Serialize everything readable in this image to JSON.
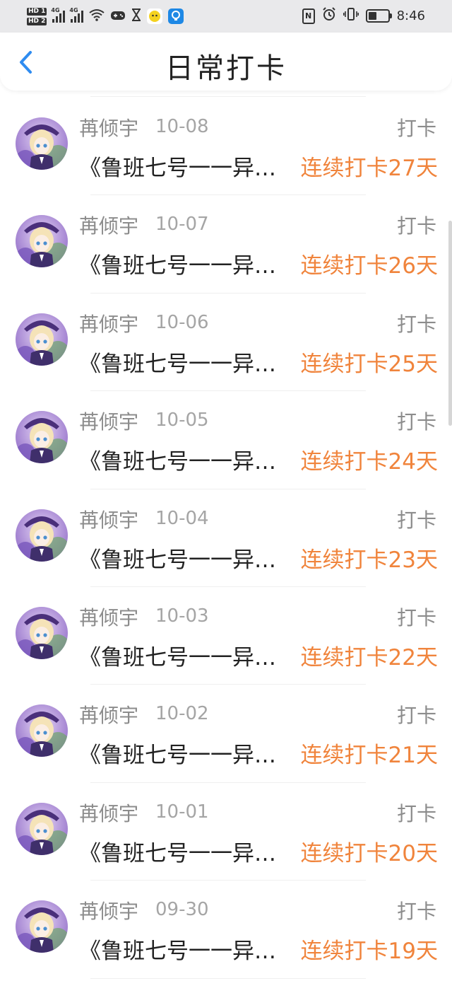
{
  "status_bar": {
    "sim1": "HD 1",
    "sim2": "HD 2",
    "network1": "4G",
    "network2": "4G",
    "time": "8:46",
    "battery_level": 0.5,
    "icons": [
      "signal-icon",
      "wifi-icon",
      "game-icon",
      "hourglass-icon",
      "app-icon",
      "app-icon",
      "nfc-icon",
      "alarm-icon",
      "vibrate-icon",
      "battery-icon"
    ]
  },
  "header": {
    "back_icon": "chevron-left-icon",
    "title": "日常打卡",
    "accent_color": "#2f8cf0"
  },
  "colors": {
    "streak": "#f0843c",
    "muted": "#8c8c8c"
  },
  "entries": [
    {
      "name": "苒倾宇",
      "date": "10-08",
      "action": "打卡",
      "book": "《鲁班七号一一异…",
      "streak": "连续打卡27天"
    },
    {
      "name": "苒倾宇",
      "date": "10-07",
      "action": "打卡",
      "book": "《鲁班七号一一异…",
      "streak": "连续打卡26天"
    },
    {
      "name": "苒倾宇",
      "date": "10-06",
      "action": "打卡",
      "book": "《鲁班七号一一异…",
      "streak": "连续打卡25天"
    },
    {
      "name": "苒倾宇",
      "date": "10-05",
      "action": "打卡",
      "book": "《鲁班七号一一异…",
      "streak": "连续打卡24天"
    },
    {
      "name": "苒倾宇",
      "date": "10-04",
      "action": "打卡",
      "book": "《鲁班七号一一异…",
      "streak": "连续打卡23天"
    },
    {
      "name": "苒倾宇",
      "date": "10-03",
      "action": "打卡",
      "book": "《鲁班七号一一异…",
      "streak": "连续打卡22天"
    },
    {
      "name": "苒倾宇",
      "date": "10-02",
      "action": "打卡",
      "book": "《鲁班七号一一异…",
      "streak": "连续打卡21天"
    },
    {
      "name": "苒倾宇",
      "date": "10-01",
      "action": "打卡",
      "book": "《鲁班七号一一异…",
      "streak": "连续打卡20天"
    },
    {
      "name": "苒倾宇",
      "date": "09-30",
      "action": "打卡",
      "book": "《鲁班七号一一异…",
      "streak": "连续打卡19天"
    }
  ]
}
